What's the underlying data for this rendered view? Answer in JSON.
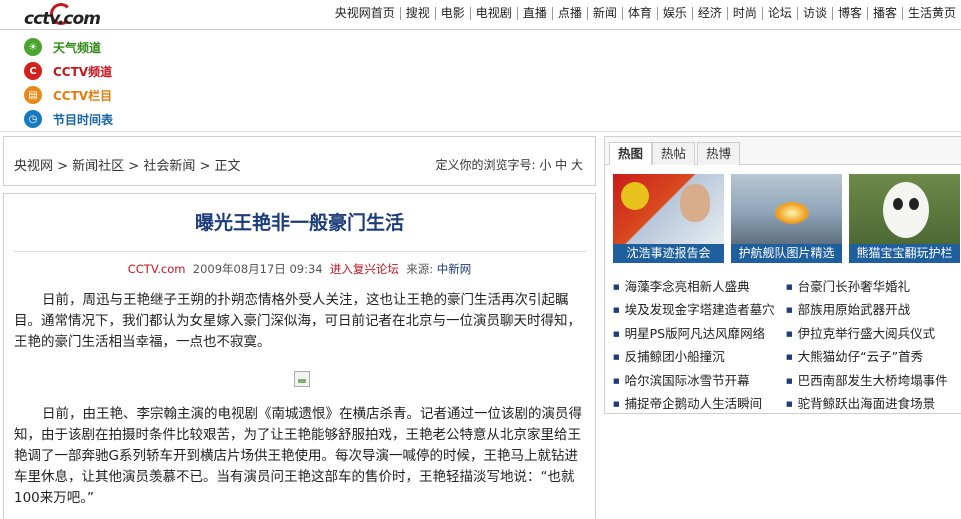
{
  "logo": {
    "text": "cctv.com"
  },
  "top_nav": [
    "央视网首页",
    "搜视",
    "电影",
    "电视剧",
    "直播",
    "点播",
    "新闻",
    "体育",
    "娱乐",
    "经济",
    "时尚",
    "论坛",
    "访谈",
    "博客",
    "播客",
    "生活黄页"
  ],
  "channels": [
    {
      "label": "天气频道",
      "icon": "weather-icon"
    },
    {
      "label": "CCTV频道",
      "icon": "cctv-icon"
    },
    {
      "label": "CCTV栏目",
      "icon": "column-icon"
    },
    {
      "label": "节目时间表",
      "icon": "schedule-icon"
    }
  ],
  "breadcrumb": {
    "text": "央视网 > 新闻社区 > 社会新闻 > 正文"
  },
  "font_size": {
    "label": "定义你的浏览字号: 小 中 大"
  },
  "article": {
    "title": "曝光王艳非一般豪门生活",
    "source_site": "CCTV.com",
    "datetime": "2009年08月17日 09:34",
    "forum_link": "进入复兴论坛",
    "source_label": "来源:",
    "source_agency": "中新网",
    "paragraphs": [
      "日前，周迅与王艳继子王朔的扑朔恋情格外受人关注，这也让王艳的豪门生活再次引起瞩目。通常情况下，我们都认为女星嫁入豪门深似海，可日前记者在北京与一位演员聊天时得知，王艳的豪门生活相当幸福，一点也不寂寞。",
      "日前，由王艳、李宗翰主演的电视剧《南城遗恨》在横店杀青。记者通过一位该剧的演员得知，由于该剧在拍摄时条件比较艰苦，为了让王艳能够舒服拍戏，王艳老公特意从北京家里给王艳调了一部奔驰G系列轿车开到横店片场供王艳使用。每次导演一喊停的时候，王艳马上就钻进车里休息，让其他演员羡慕不已。当有演员问王艳这部车的售价时，王艳轻描淡写地说：“也就100来万吧。”"
    ]
  },
  "side_panel": {
    "tabs": [
      "热图",
      "热帖",
      "热博"
    ],
    "photos": [
      {
        "caption": "沈浩事迹报告会"
      },
      {
        "caption": "护航舰队图片精选"
      },
      {
        "caption": "熊猫宝宝翻玩护栏"
      }
    ],
    "news": [
      [
        "海藻李念亮相新人盛典",
        "台豪门长孙奢华婚礼"
      ],
      [
        "埃及发现金字塔建造者墓穴",
        "部族用原始武器开战"
      ],
      [
        "明星PS版阿凡达风靡网络",
        "伊拉克举行盛大阅兵仪式"
      ],
      [
        "反捕鲸团小船撞沉",
        "大熊猫幼仔“云子”首秀"
      ],
      [
        "哈尔滨国际冰雪节开幕",
        "巴西南部发生大桥垮塌事件"
      ],
      [
        "捕捉帝企鹅动人生活瞬间",
        "驼背鲸跃出海面进食场景"
      ]
    ]
  }
}
